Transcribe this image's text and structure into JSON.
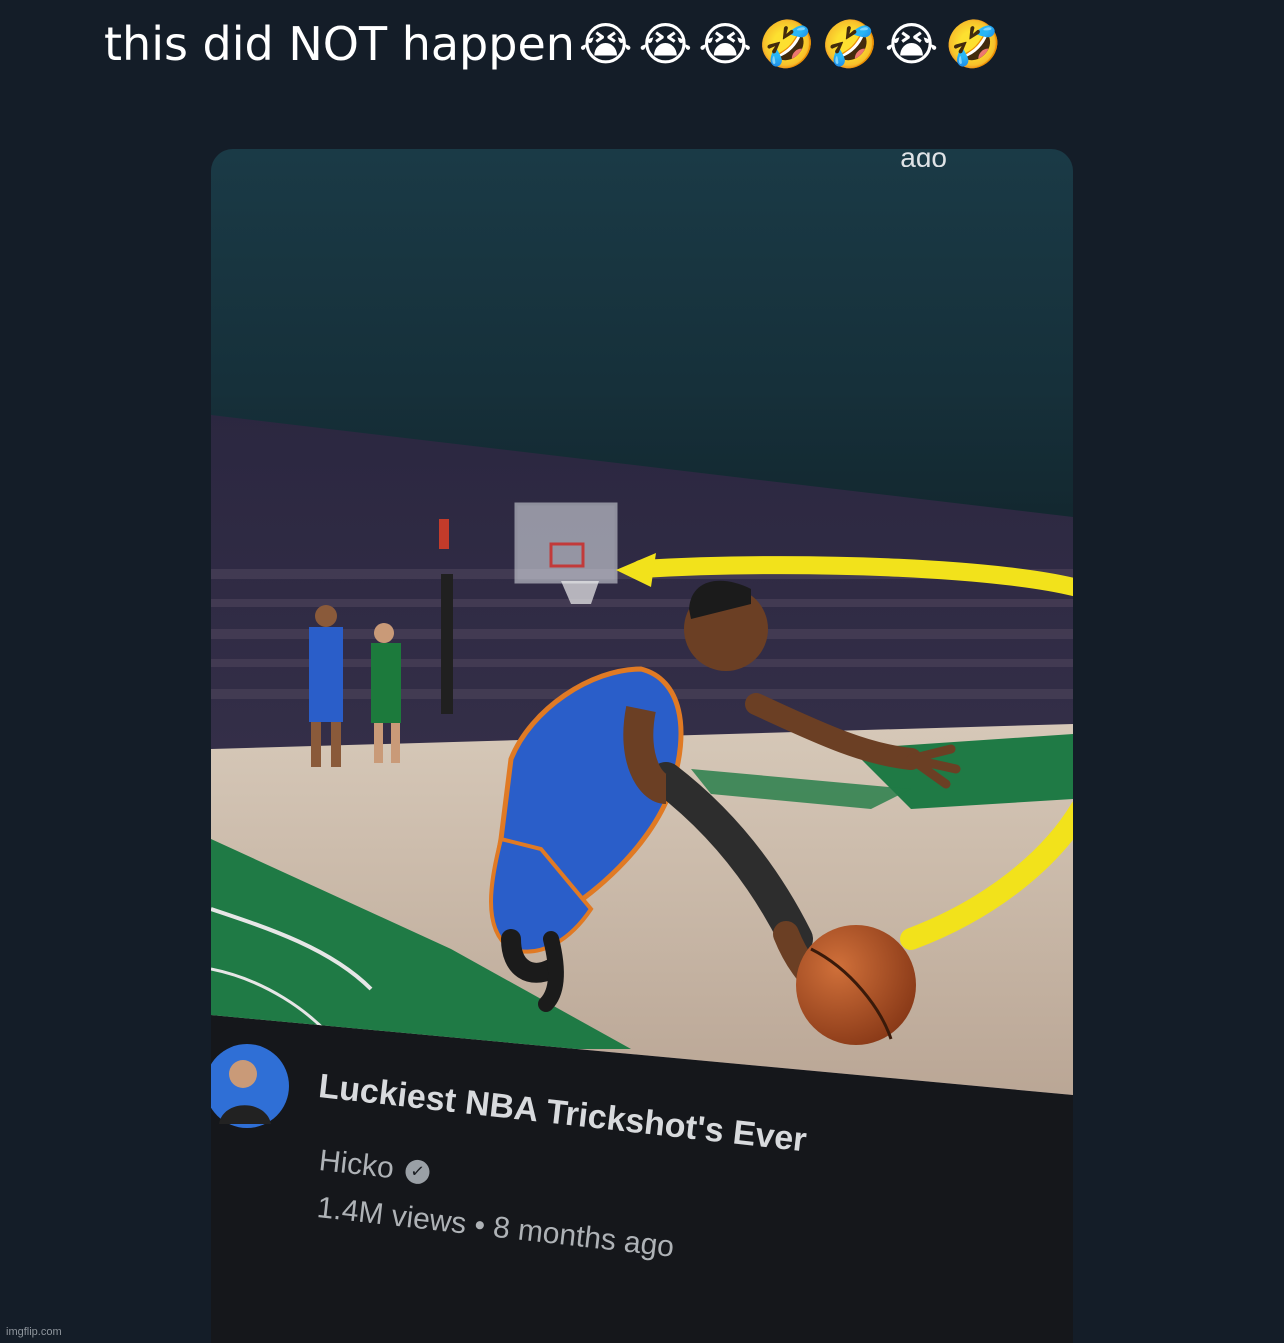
{
  "post": {
    "text": "this did NOT happen",
    "emojis": "😭😭😭🤣🤣😭🤣"
  },
  "video": {
    "title": "Luckiest NBA Trickshot's Ever",
    "channel": "Hicko",
    "views": "1.4M views",
    "separator": " • ",
    "age": "8 months ago"
  },
  "watermark": "imgflip.com",
  "colors": {
    "background": "#141d28",
    "court_green": "#1f7a45",
    "knicks_blue": "#2a5ec9",
    "knicks_orange": "#e07a24",
    "highlight_arrow": "#f2e21b"
  },
  "icons": {
    "verified": "check-circle-icon",
    "channel_avatar": "avatar-person"
  }
}
